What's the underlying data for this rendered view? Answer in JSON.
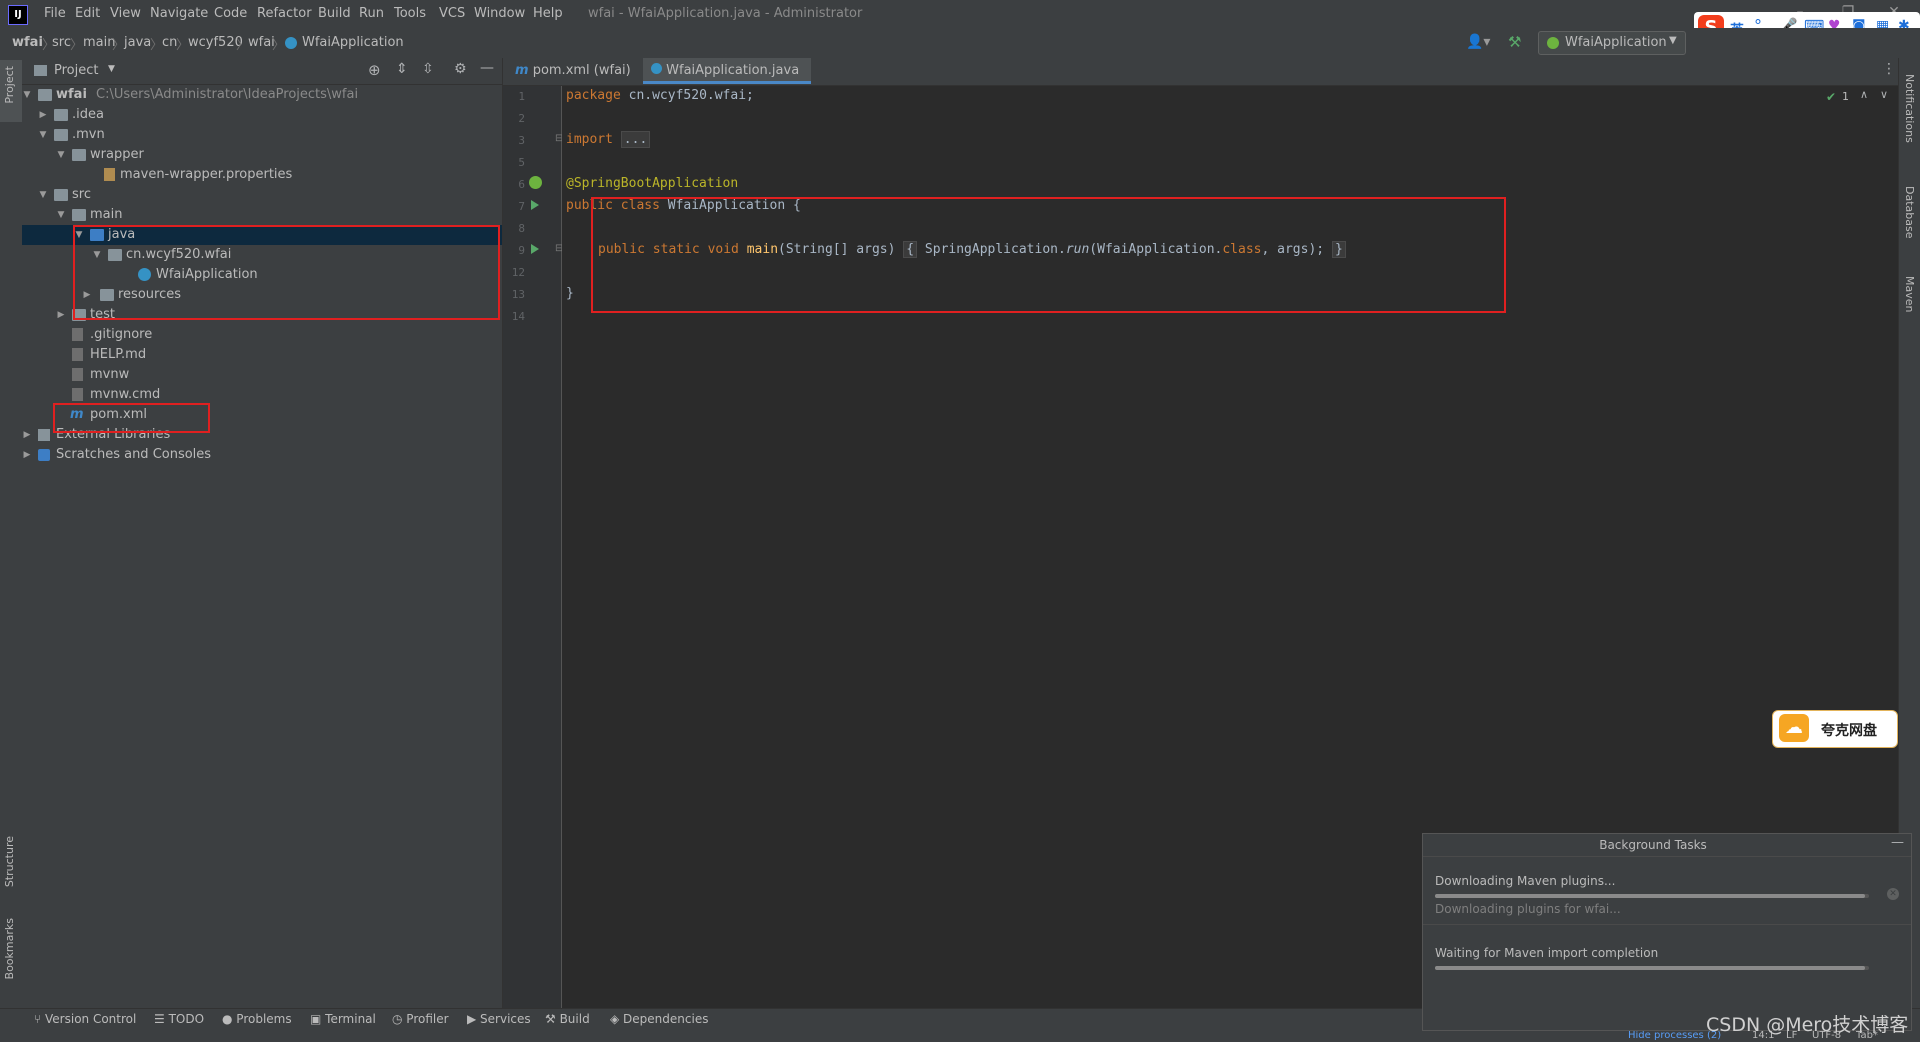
{
  "titlebar": {
    "menus": [
      "File",
      "Edit",
      "View",
      "Navigate",
      "Code",
      "Refactor",
      "Build",
      "Run",
      "Tools",
      "VCS",
      "Window",
      "Help"
    ],
    "window_title": "wfai - WfaiApplication.java - Administrator",
    "app_logo": "IJ"
  },
  "navbar": {
    "breadcrumbs": [
      "wfai",
      "src",
      "main",
      "java",
      "cn",
      "wcyf520",
      "wfai",
      "WfaiApplication"
    ],
    "run_config": "WfaiApplication"
  },
  "left_stripe": {
    "top_tab": "Project",
    "structure_tab": "Structure",
    "bookmarks_tab": "Bookmarks"
  },
  "right_stripe": {
    "tabs": [
      "Notifications",
      "Database",
      "Maven"
    ]
  },
  "project_panel": {
    "header_label": "Project",
    "tree": [
      {
        "label": "wfai",
        "hint": "C:\\Users\\Administrator\\IdeaProjects\\wfai"
      },
      {
        "label": ".idea"
      },
      {
        "label": ".mvn"
      },
      {
        "label": "wrapper"
      },
      {
        "label": "maven-wrapper.properties"
      },
      {
        "label": "src"
      },
      {
        "label": "main"
      },
      {
        "label": "java"
      },
      {
        "label": "cn.wcyf520.wfai"
      },
      {
        "label": "WfaiApplication"
      },
      {
        "label": "resources"
      },
      {
        "label": "test"
      },
      {
        "label": ".gitignore"
      },
      {
        "label": "HELP.md"
      },
      {
        "label": "mvnw"
      },
      {
        "label": "mvnw.cmd"
      },
      {
        "label": "pom.xml"
      },
      {
        "label": "External Libraries"
      },
      {
        "label": "Scratches and Consoles"
      }
    ]
  },
  "editor": {
    "tabs": [
      "pom.xml (wfai)",
      "WfaiApplication.java"
    ],
    "line_numbers": [
      "1",
      "2",
      "3",
      "5",
      "6",
      "7",
      "8",
      "9",
      "12",
      "13",
      "14"
    ],
    "code": {
      "l1_kw": "package",
      "l1_rest": " cn.wcyf520.wfai;",
      "l3_kw": "import",
      "l3_fold": "...",
      "l6": "@SpringBootApplication",
      "l7_kw": "public class",
      "l7_rest": " WfaiApplication {",
      "l9_kw": "public static void",
      "l9_fn": "main",
      "l9_args": "(String[] args)",
      "l9_open": "{",
      "l9_body1": " SpringApplication.",
      "l9_run": "run",
      "l9_body2": "(WfaiApplication.",
      "l9_class": "class",
      "l9_body3": ", args);",
      "l9_close": "}",
      "l13": "}"
    },
    "inspection": "1"
  },
  "bottom_tools": [
    "Version Control",
    "TODO",
    "Problems",
    "Terminal",
    "Profiler",
    "Services",
    "Build",
    "Dependencies"
  ],
  "background_tasks": {
    "title": "Background Tasks",
    "task1_title": "Downloading Maven plugins...",
    "task1_sub": "Downloading plugins for wfai...",
    "task1_progress": 0.99,
    "task2_title": "Waiting for Maven import completion",
    "task2_progress": 0.99
  },
  "status": {
    "hide_processes": "Hide processes (2)",
    "position": "14:1",
    "line_sep": "LF",
    "encoding": "UTF-8",
    "indent": "Tab*"
  },
  "popups": {
    "quark_label": "夸克网盘",
    "ime_lang": "英"
  },
  "watermark": "CSDN @Mero技术博客",
  "colors": {
    "keyword": "#cc7832",
    "annotation": "#bbb529",
    "function": "#ffc66d",
    "selection": "#0d293e",
    "highlight_box": "#e02020"
  }
}
